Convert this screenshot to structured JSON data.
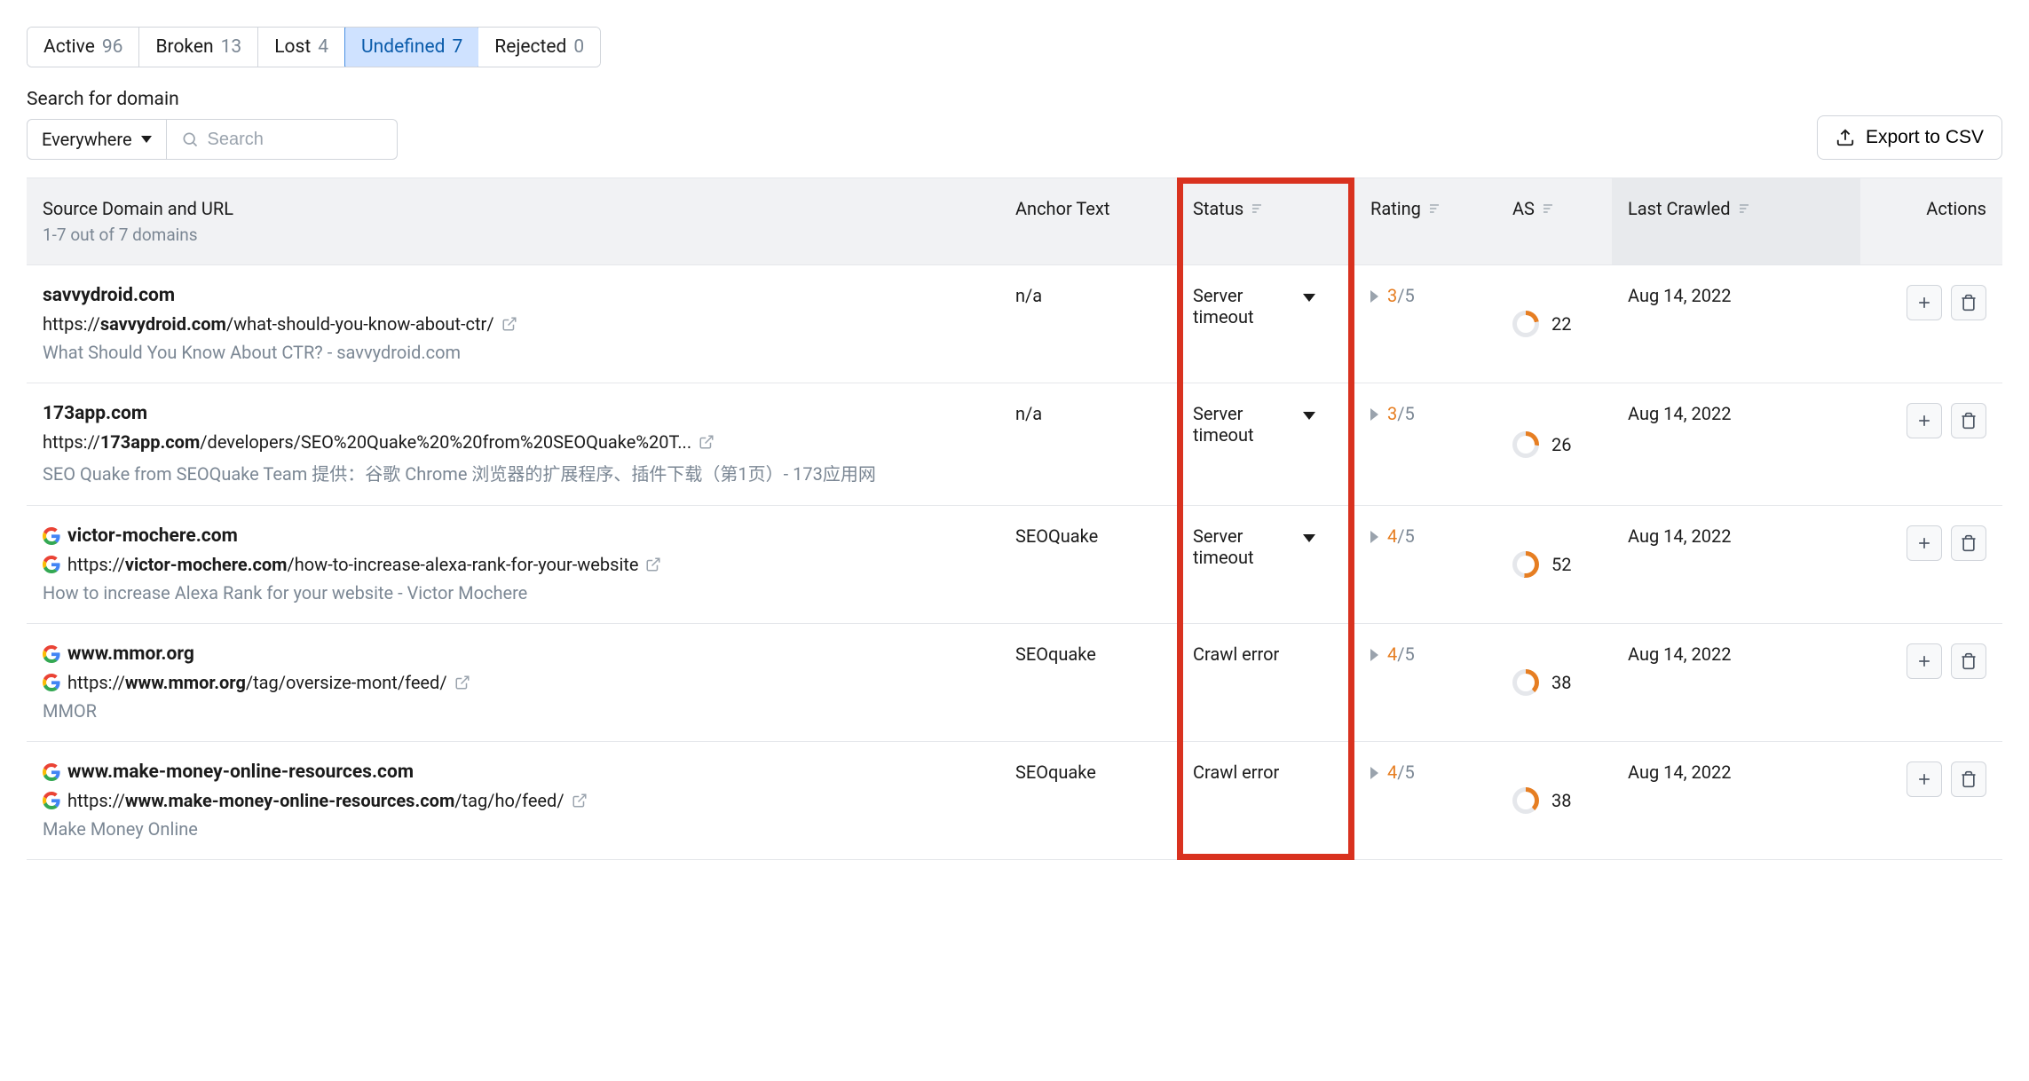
{
  "tabs": [
    {
      "label": "Active",
      "count": "96"
    },
    {
      "label": "Broken",
      "count": "13"
    },
    {
      "label": "Lost",
      "count": "4"
    },
    {
      "label": "Undefined",
      "count": "7",
      "active": true
    },
    {
      "label": "Rejected",
      "count": "0"
    }
  ],
  "search": {
    "label": "Search for domain",
    "scope": "Everywhere",
    "placeholder": "Search"
  },
  "export_label": "Export to CSV",
  "columns": {
    "source": "Source Domain and URL",
    "source_sub": "1-7 out of 7 domains",
    "anchor": "Anchor Text",
    "status": "Status",
    "rating": "Rating",
    "as": "AS",
    "crawled": "Last Crawled",
    "actions": "Actions"
  },
  "rows": [
    {
      "domain": "savvydroid.com",
      "url_prefix": "https://",
      "url_bold": "savvydroid.com",
      "url_rest": "/what-should-you-know-about-ctr/",
      "title": "What Should You Know About CTR? - savvydroid.com",
      "anchor": "n/a",
      "status": "Server timeout",
      "show_chevron": true,
      "rating_num": "3",
      "rating_den": "/5",
      "as": "22",
      "as_pct": 22,
      "crawled": "Aug 14, 2022",
      "has_g": false
    },
    {
      "domain": "173app.com",
      "url_prefix": "https://",
      "url_bold": "173app.com",
      "url_rest": "/developers/SEO%20Quake%20%20from%20SEOQuake%20T...",
      "title": "SEO Quake from SEOQuake Team 提供：谷歌 Chrome 浏览器的扩展程序、插件下载（第1页）- 173应用网",
      "anchor": "n/a",
      "status": "Server timeout",
      "show_chevron": true,
      "rating_num": "3",
      "rating_den": "/5",
      "as": "26",
      "as_pct": 26,
      "crawled": "Aug 14, 2022",
      "has_g": false
    },
    {
      "domain": "victor-mochere.com",
      "url_prefix": "https://",
      "url_bold": "victor-mochere.com",
      "url_rest": "/how-to-increase-alexa-rank-for-your-website",
      "title": "How to increase Alexa Rank for your website - Victor Mochere",
      "anchor": "SEOQuake",
      "status": "Server timeout",
      "show_chevron": true,
      "rating_num": "4",
      "rating_den": "/5",
      "as": "52",
      "as_pct": 52,
      "crawled": "Aug 14, 2022",
      "has_g": true
    },
    {
      "domain": "www.mmor.org",
      "url_prefix": "https://",
      "url_bold": "www.mmor.org",
      "url_rest": "/tag/oversize-mont/feed/",
      "title": "MMOR",
      "anchor": "SEOquake",
      "status": "Crawl error",
      "show_chevron": false,
      "rating_num": "4",
      "rating_den": "/5",
      "as": "38",
      "as_pct": 38,
      "crawled": "Aug 14, 2022",
      "has_g": true
    },
    {
      "domain": "www.make-money-online-resources.com",
      "url_prefix": "https://",
      "url_bold": "www.make-money-online-resources.com",
      "url_rest": "/tag/ho/feed/",
      "title": "Make Money Online",
      "anchor": "SEOquake",
      "status": "Crawl error",
      "show_chevron": false,
      "rating_num": "4",
      "rating_den": "/5",
      "as": "38",
      "as_pct": 38,
      "crawled": "Aug 14, 2022",
      "has_g": true
    }
  ]
}
